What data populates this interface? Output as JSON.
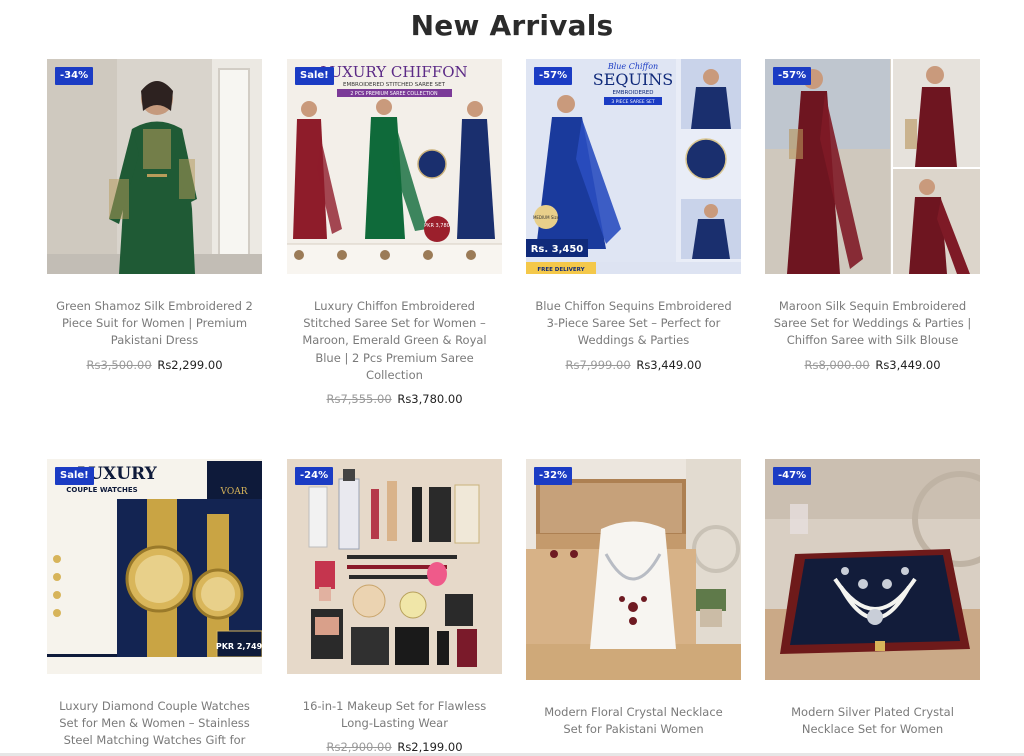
{
  "section_title": "New Arrivals",
  "accent_color": "#1b3cc4",
  "products": [
    {
      "badge": "-34%",
      "title": "Green Shamoz Silk Embroidered 2 Piece Suit for Women | Premium Pakistani Dress",
      "old_price": "Rs3,500.00",
      "price": "Rs2,299.00",
      "image": "woman-green-embroidered-suit"
    },
    {
      "badge": "Sale!",
      "title": "Luxury Chiffon Embroidered Stitched Saree Set for Women – Maroon, Emerald Green & Royal Blue | 2 Pcs Premium Saree Collection",
      "old_price": "Rs7,555.00",
      "price": "Rs3,780.00",
      "image": "three-saree-models-banner",
      "image_text": {
        "headline": "LUXURY CHIFFON",
        "subline": "EMBROIDERED STITCHED SAREE SET",
        "tag": "2 PCS PREMIUM SAREE COLLECTION",
        "price_circle": "PKR 3,780"
      }
    },
    {
      "badge": "-57%",
      "title": "Blue Chiffon Sequins Embroidered 3-Piece Saree Set – Perfect for Weddings & Parties",
      "old_price": "Rs7,999.00",
      "price": "Rs3,449.00",
      "image": "blue-sequin-saree-banner",
      "image_text": {
        "headline": "Blue Chiffon",
        "headline2": "SEQUINS",
        "subline": "EMBROIDERED",
        "tag": "3 PIECE SAREE SET",
        "price_tag": "Rs. 3,450",
        "delivery": "FREE DELIVERY",
        "size": "MEDIUM Size"
      }
    },
    {
      "badge": "-57%",
      "title": "Maroon Silk Sequin Embroidered Saree Set for Weddings & Parties | Chiffon Saree with Silk Blouse",
      "old_price": "Rs8,000.00",
      "price": "Rs3,449.00",
      "image": "maroon-saree-collage"
    },
    {
      "badge": "Sale!",
      "title": "Luxury Diamond Couple Watches Set for Men & Women – Stainless Steel Matching Watches Gift for",
      "old_price": "",
      "price": "",
      "image": "gold-couple-watches-box",
      "image_text": {
        "headline": "LUXURY",
        "subline": "COUPLE WATCHES",
        "brand": "VOAR",
        "price_tag": "PKR 2,749"
      }
    },
    {
      "badge": "-24%",
      "title": "16-in-1 Makeup Set for Flawless Long-Lasting Wear",
      "old_price": "Rs2,900.00",
      "price": "Rs2,199.00",
      "image": "makeup-flatlay"
    },
    {
      "badge": "-32%",
      "title": "Modern Floral Crystal Necklace Set for Pakistani Women",
      "old_price": "",
      "price": "",
      "image": "necklace-in-wooden-box"
    },
    {
      "badge": "-47%",
      "title": "Modern Silver Plated Crystal Necklace Set for Women",
      "old_price": "",
      "price": "",
      "image": "pearl-necklace-in-box"
    }
  ]
}
